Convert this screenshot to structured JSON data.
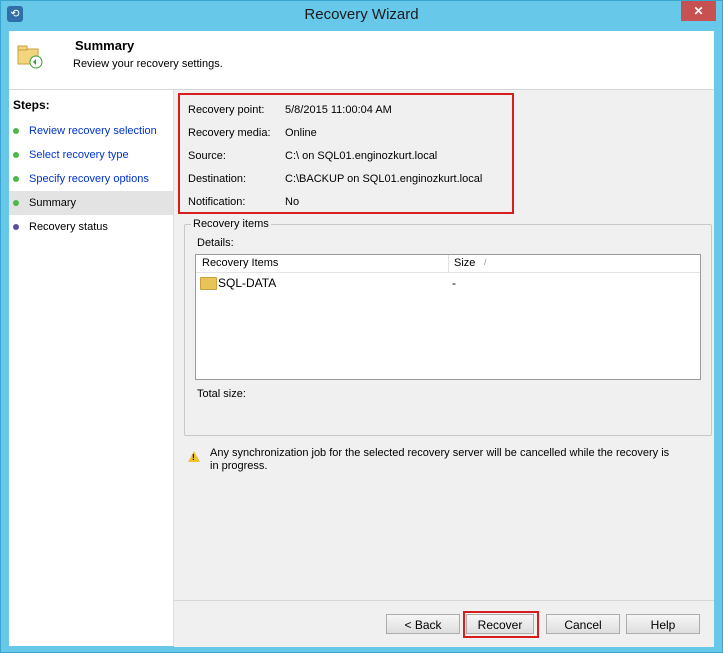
{
  "window": {
    "title": "Recovery Wizard",
    "close_label": "✕"
  },
  "header": {
    "title": "Summary",
    "subtitle": "Review your recovery settings."
  },
  "steps": {
    "title": "Steps:",
    "items": [
      {
        "label": "Review recovery selection",
        "status": "complete",
        "dot_color": "#4cb848"
      },
      {
        "label": "Select recovery type",
        "status": "complete",
        "dot_color": "#4cb848"
      },
      {
        "label": "Specify recovery options",
        "status": "complete",
        "dot_color": "#4cb848"
      },
      {
        "label": "Summary",
        "status": "current",
        "dot_color": "#4cb848"
      },
      {
        "label": "Recovery status",
        "status": "pending",
        "dot_color": "#5b4fa3"
      }
    ]
  },
  "summary": [
    {
      "label": "Recovery point:",
      "value": "5/8/2015 11:00:04 AM"
    },
    {
      "label": "Recovery media:",
      "value": "Online"
    },
    {
      "label": "Source:",
      "value": "C:\\ on SQL01.enginozkurt.local"
    },
    {
      "label": "Destination:",
      "value": "C:\\BACKUP on SQL01.enginozkurt.local"
    },
    {
      "label": "Notification:",
      "value": "No"
    }
  ],
  "recovery_items": {
    "group_title": "Recovery items",
    "details_label": "Details:",
    "columns": [
      "Recovery Items",
      "Size"
    ],
    "sort_indicator": "/",
    "rows": [
      {
        "name": "SQL-DATA",
        "size": "-"
      }
    ],
    "total_label": "Total size:"
  },
  "warning": {
    "text": "Any synchronization job for the selected recovery server will be cancelled while the recovery is in progress."
  },
  "buttons": {
    "back": "< Back",
    "recover": "Recover",
    "cancel": "Cancel",
    "help": "Help"
  },
  "colors": {
    "highlight": "#d71e1e",
    "link": "#0033cc",
    "titlebar": "#67c8ea"
  }
}
